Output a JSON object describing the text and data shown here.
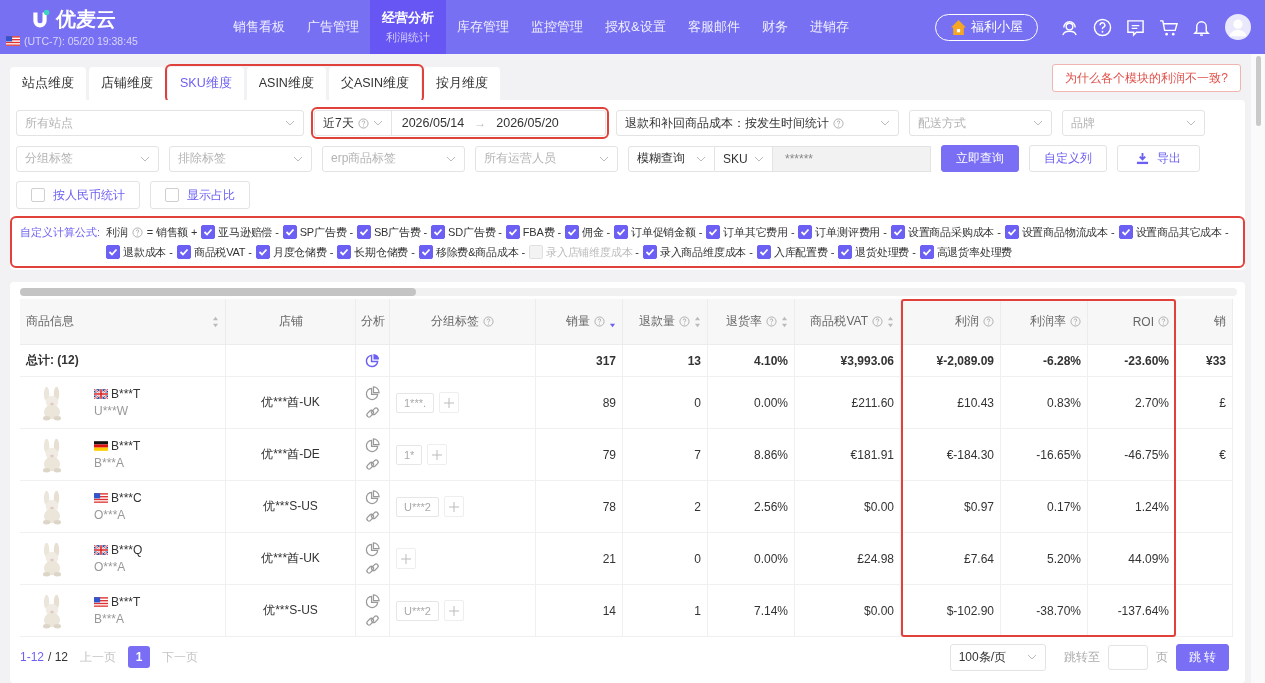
{
  "header": {
    "brand": "优麦云",
    "clock": "(UTC-7): 05/20 19:38:45",
    "welfare": "福利小屋",
    "nav": [
      {
        "label": "销售看板",
        "selected": false
      },
      {
        "label": "广告管理",
        "selected": false
      },
      {
        "label": "经营分析",
        "selected": true,
        "sub": "利润统计"
      },
      {
        "label": "库存管理",
        "selected": false
      },
      {
        "label": "监控管理",
        "selected": false
      },
      {
        "label": "授权&设置",
        "selected": false
      },
      {
        "label": "客服邮件",
        "selected": false
      },
      {
        "label": "财务",
        "selected": false
      },
      {
        "label": "进销存",
        "selected": false
      }
    ]
  },
  "tabs": [
    {
      "label": "站点维度",
      "selected": false,
      "highlighted": false
    },
    {
      "label": "店铺维度",
      "selected": false,
      "highlighted": false
    },
    {
      "label": "SKU维度",
      "selected": true,
      "highlighted": true
    },
    {
      "label": "ASIN维度",
      "selected": false,
      "highlighted": true
    },
    {
      "label": "父ASIN维度",
      "selected": false,
      "highlighted": true
    },
    {
      "label": "按月维度",
      "selected": false,
      "highlighted": false
    }
  ],
  "notice_button": "为什么各个模块的利润不一致?",
  "filters": {
    "site": {
      "placeholder": "所有站点"
    },
    "date_range": {
      "preset": "近7天",
      "start": "2026/05/14",
      "arrow": "→",
      "end": "2026/05/20",
      "highlighted": true
    },
    "cost_mode": {
      "value": "退款和补回商品成本：按发生时间统计"
    },
    "shipping": {
      "placeholder": "配送方式"
    },
    "brand": {
      "placeholder": "品牌"
    },
    "group_tag": {
      "placeholder": "分组标签"
    },
    "exclude_tag": {
      "placeholder": "排除标签"
    },
    "erp_tag": {
      "placeholder": "erp商品标签"
    },
    "operator": {
      "placeholder": "所有运营人员"
    },
    "match_mode": "模糊查询",
    "search_field": "SKU",
    "search_value": "******",
    "query_button": "立即查询",
    "columns_button": "自定义列",
    "export_button": "导出",
    "options": [
      {
        "label": "按人民币统计",
        "checked": false
      },
      {
        "label": "显示占比",
        "checked": false
      }
    ]
  },
  "formula": {
    "label": "自定义计算公式:",
    "target": "利润",
    "lead": "= 销售额 +",
    "highlighted": true,
    "items": [
      {
        "label": "亚马逊赔偿",
        "checked": true,
        "disabled": false,
        "op": "-"
      },
      {
        "label": "SP广告费",
        "checked": true,
        "disabled": false,
        "op": "-"
      },
      {
        "label": "SB广告费",
        "checked": true,
        "disabled": false,
        "op": "-"
      },
      {
        "label": "SD广告费",
        "checked": true,
        "disabled": false,
        "op": "-"
      },
      {
        "label": "FBA费",
        "checked": true,
        "disabled": false,
        "op": "-"
      },
      {
        "label": "佣金",
        "checked": true,
        "disabled": false,
        "op": "-"
      },
      {
        "label": "订单促销金额",
        "checked": true,
        "disabled": false,
        "op": "-"
      },
      {
        "label": "订单其它费用",
        "checked": true,
        "disabled": false,
        "op": "-"
      },
      {
        "label": "订单测评费用",
        "checked": true,
        "disabled": false,
        "op": "-"
      },
      {
        "label": "设置商品采购成本",
        "checked": true,
        "disabled": false,
        "op": "-"
      },
      {
        "label": "设置商品物流成本",
        "checked": true,
        "disabled": false,
        "op": "-"
      },
      {
        "label": "设置商品其它成本",
        "checked": true,
        "disabled": false,
        "op": "-"
      },
      {
        "label": "退款成本",
        "checked": true,
        "disabled": false,
        "op": "-"
      },
      {
        "label": "商品税VAT",
        "checked": true,
        "disabled": false,
        "op": "-"
      },
      {
        "label": "月度仓储费",
        "checked": true,
        "disabled": false,
        "op": "-"
      },
      {
        "label": "长期仓储费",
        "checked": true,
        "disabled": false,
        "op": "-"
      },
      {
        "label": "移除费&商品成本",
        "checked": true,
        "disabled": false,
        "op": "-"
      },
      {
        "label": "录入店铺维度成本",
        "checked": false,
        "disabled": true,
        "op": "-"
      },
      {
        "label": "录入商品维度成本",
        "checked": true,
        "disabled": false,
        "op": "-"
      },
      {
        "label": "入库配置费",
        "checked": true,
        "disabled": false,
        "op": "-"
      },
      {
        "label": "退货处理费",
        "checked": true,
        "disabled": false,
        "op": "-"
      },
      {
        "label": "高退货率处理费",
        "checked": true,
        "disabled": false
      }
    ]
  },
  "table": {
    "columns": [
      {
        "label": "商品信息",
        "kind": "product",
        "help": false,
        "sortable": true,
        "sorted": false,
        "highlighted": false
      },
      {
        "label": "店铺",
        "kind": "store",
        "help": false,
        "highlighted": false
      },
      {
        "label": "分析",
        "kind": "analysis",
        "help": false,
        "highlighted": false
      },
      {
        "label": "分组标签",
        "kind": "tags",
        "help": true,
        "highlighted": false
      },
      {
        "label": "销量",
        "kind": "number",
        "help": true,
        "sortable": true,
        "sorted": true,
        "highlighted": false
      },
      {
        "label": "退款量",
        "kind": "number",
        "help": true,
        "sortable": true,
        "sorted": false,
        "highlighted": false
      },
      {
        "label": "退货率",
        "kind": "number",
        "help": true,
        "sortable": true,
        "sorted": false,
        "highlighted": false
      },
      {
        "label": "商品税VAT",
        "kind": "number",
        "help": true,
        "sortable": true,
        "sorted": false,
        "highlighted": false
      },
      {
        "label": "利润",
        "kind": "number",
        "help": true,
        "highlighted": true
      },
      {
        "label": "利润率",
        "kind": "number",
        "help": true,
        "highlighted": true
      },
      {
        "label": "ROI",
        "kind": "number",
        "help": true,
        "highlighted": true
      },
      {
        "label": "销",
        "kind": "number",
        "help": false,
        "highlighted": false
      }
    ],
    "total": {
      "label": "总计: (12)",
      "values": [
        "317",
        "13",
        "4.10%",
        "¥3,993.06",
        "¥-2,089.09",
        "-6.28%",
        "-23.60%",
        "¥33"
      ]
    },
    "rows": [
      {
        "flag": {
          "kind": "uk"
        },
        "asin": "B***T",
        "sku": "U***W",
        "store": "优***酋-UK",
        "tags": [
          "1***."
        ],
        "values": [
          "89",
          "0",
          "0.00%",
          "£211.60",
          "£10.43",
          "0.83%",
          "2.70%",
          "£"
        ]
      },
      {
        "flag": {
          "kind": "de"
        },
        "asin": "B***T",
        "sku": "B***A",
        "store": "优***酋-DE",
        "tags": [
          "1*"
        ],
        "values": [
          "79",
          "7",
          "8.86%",
          "€181.91",
          "€-184.30",
          "-16.65%",
          "-46.75%",
          "€"
        ]
      },
      {
        "flag": {
          "kind": "us"
        },
        "asin": "B***C",
        "sku": "O***A",
        "store": "优***S-US",
        "tags": [
          "U***2"
        ],
        "values": [
          "78",
          "2",
          "2.56%",
          "$0.00",
          "$0.97",
          "0.17%",
          "1.24%"
        ]
      },
      {
        "flag": {
          "kind": "uk"
        },
        "asin": "B***Q",
        "sku": "O***A",
        "store": "优***酋-UK",
        "tags": [],
        "values": [
          "21",
          "0",
          "0.00%",
          "£24.98",
          "£7.64",
          "5.20%",
          "44.09%"
        ]
      },
      {
        "flag": {
          "kind": "us"
        },
        "asin": "B***T",
        "sku": "B***A",
        "store": "优***S-US",
        "tags": [
          "U***2"
        ],
        "values": [
          "14",
          "1",
          "7.14%",
          "$0.00",
          "$-102.90",
          "-38.70%",
          "-137.64%"
        ]
      }
    ]
  },
  "pagination": {
    "range": "1-12",
    "total": "/ 12",
    "prev": "上一页",
    "next": "下一页",
    "pages": [
      {
        "label": "1",
        "selected": true
      }
    ],
    "page_size": "100条/页",
    "jump_label": "跳转至",
    "page_unit": "页",
    "jump_button": "跳 转"
  }
}
